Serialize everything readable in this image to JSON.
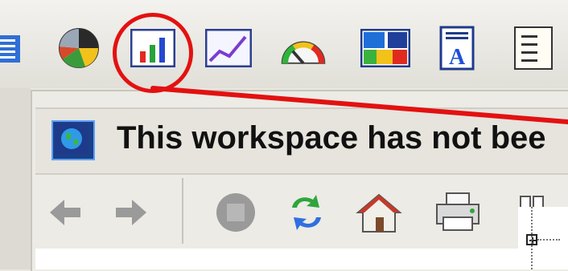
{
  "toolbar": {
    "icons": [
      "list-icon",
      "pie-chart-icon",
      "bar-chart-icon",
      "line-chart-icon",
      "gauge-icon",
      "scale-icon",
      "text-document-icon",
      "report-icon"
    ]
  },
  "window": {
    "title": "This workspace has not bee"
  },
  "navigation": {
    "buttons": [
      "back-arrow-icon",
      "forward-arrow-icon",
      "stop-icon",
      "refresh-icon",
      "home-icon",
      "print-icon",
      "binoculars-icon"
    ]
  },
  "highlight": {
    "color": "#e31111",
    "target": "bar-chart-icon"
  }
}
